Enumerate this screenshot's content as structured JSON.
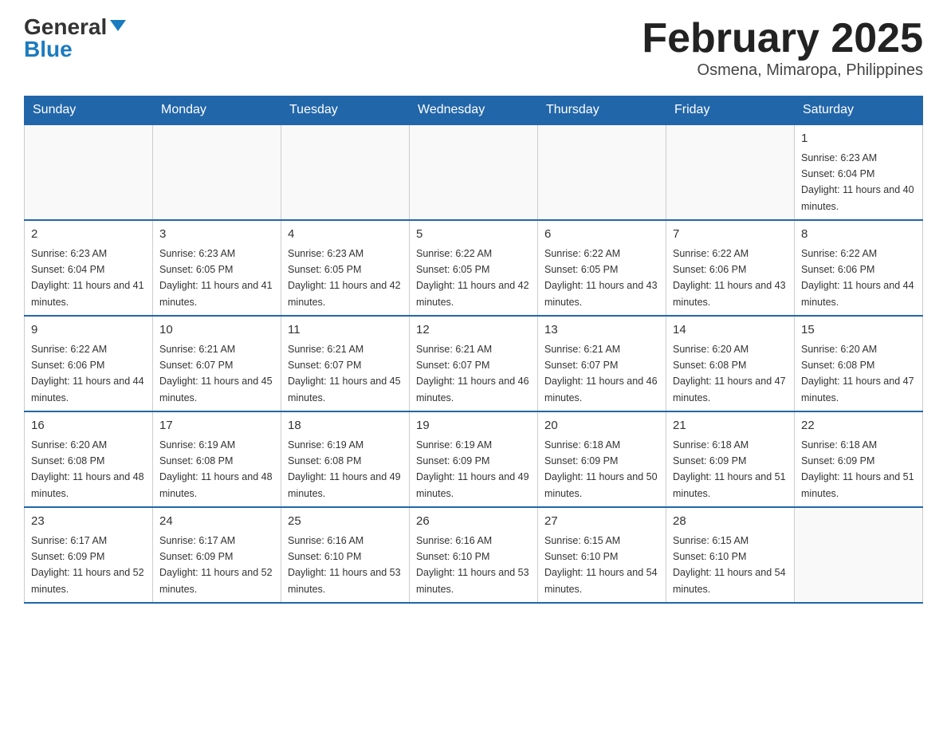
{
  "logo": {
    "general": "General",
    "blue": "Blue"
  },
  "title": "February 2025",
  "location": "Osmena, Mimaropa, Philippines",
  "days_of_week": [
    "Sunday",
    "Monday",
    "Tuesday",
    "Wednesday",
    "Thursday",
    "Friday",
    "Saturday"
  ],
  "weeks": [
    [
      {
        "day": "",
        "info": ""
      },
      {
        "day": "",
        "info": ""
      },
      {
        "day": "",
        "info": ""
      },
      {
        "day": "",
        "info": ""
      },
      {
        "day": "",
        "info": ""
      },
      {
        "day": "",
        "info": ""
      },
      {
        "day": "1",
        "info": "Sunrise: 6:23 AM\nSunset: 6:04 PM\nDaylight: 11 hours and 40 minutes."
      }
    ],
    [
      {
        "day": "2",
        "info": "Sunrise: 6:23 AM\nSunset: 6:04 PM\nDaylight: 11 hours and 41 minutes."
      },
      {
        "day": "3",
        "info": "Sunrise: 6:23 AM\nSunset: 6:05 PM\nDaylight: 11 hours and 41 minutes."
      },
      {
        "day": "4",
        "info": "Sunrise: 6:23 AM\nSunset: 6:05 PM\nDaylight: 11 hours and 42 minutes."
      },
      {
        "day": "5",
        "info": "Sunrise: 6:22 AM\nSunset: 6:05 PM\nDaylight: 11 hours and 42 minutes."
      },
      {
        "day": "6",
        "info": "Sunrise: 6:22 AM\nSunset: 6:05 PM\nDaylight: 11 hours and 43 minutes."
      },
      {
        "day": "7",
        "info": "Sunrise: 6:22 AM\nSunset: 6:06 PM\nDaylight: 11 hours and 43 minutes."
      },
      {
        "day": "8",
        "info": "Sunrise: 6:22 AM\nSunset: 6:06 PM\nDaylight: 11 hours and 44 minutes."
      }
    ],
    [
      {
        "day": "9",
        "info": "Sunrise: 6:22 AM\nSunset: 6:06 PM\nDaylight: 11 hours and 44 minutes."
      },
      {
        "day": "10",
        "info": "Sunrise: 6:21 AM\nSunset: 6:07 PM\nDaylight: 11 hours and 45 minutes."
      },
      {
        "day": "11",
        "info": "Sunrise: 6:21 AM\nSunset: 6:07 PM\nDaylight: 11 hours and 45 minutes."
      },
      {
        "day": "12",
        "info": "Sunrise: 6:21 AM\nSunset: 6:07 PM\nDaylight: 11 hours and 46 minutes."
      },
      {
        "day": "13",
        "info": "Sunrise: 6:21 AM\nSunset: 6:07 PM\nDaylight: 11 hours and 46 minutes."
      },
      {
        "day": "14",
        "info": "Sunrise: 6:20 AM\nSunset: 6:08 PM\nDaylight: 11 hours and 47 minutes."
      },
      {
        "day": "15",
        "info": "Sunrise: 6:20 AM\nSunset: 6:08 PM\nDaylight: 11 hours and 47 minutes."
      }
    ],
    [
      {
        "day": "16",
        "info": "Sunrise: 6:20 AM\nSunset: 6:08 PM\nDaylight: 11 hours and 48 minutes."
      },
      {
        "day": "17",
        "info": "Sunrise: 6:19 AM\nSunset: 6:08 PM\nDaylight: 11 hours and 48 minutes."
      },
      {
        "day": "18",
        "info": "Sunrise: 6:19 AM\nSunset: 6:08 PM\nDaylight: 11 hours and 49 minutes."
      },
      {
        "day": "19",
        "info": "Sunrise: 6:19 AM\nSunset: 6:09 PM\nDaylight: 11 hours and 49 minutes."
      },
      {
        "day": "20",
        "info": "Sunrise: 6:18 AM\nSunset: 6:09 PM\nDaylight: 11 hours and 50 minutes."
      },
      {
        "day": "21",
        "info": "Sunrise: 6:18 AM\nSunset: 6:09 PM\nDaylight: 11 hours and 51 minutes."
      },
      {
        "day": "22",
        "info": "Sunrise: 6:18 AM\nSunset: 6:09 PM\nDaylight: 11 hours and 51 minutes."
      }
    ],
    [
      {
        "day": "23",
        "info": "Sunrise: 6:17 AM\nSunset: 6:09 PM\nDaylight: 11 hours and 52 minutes."
      },
      {
        "day": "24",
        "info": "Sunrise: 6:17 AM\nSunset: 6:09 PM\nDaylight: 11 hours and 52 minutes."
      },
      {
        "day": "25",
        "info": "Sunrise: 6:16 AM\nSunset: 6:10 PM\nDaylight: 11 hours and 53 minutes."
      },
      {
        "day": "26",
        "info": "Sunrise: 6:16 AM\nSunset: 6:10 PM\nDaylight: 11 hours and 53 minutes."
      },
      {
        "day": "27",
        "info": "Sunrise: 6:15 AM\nSunset: 6:10 PM\nDaylight: 11 hours and 54 minutes."
      },
      {
        "day": "28",
        "info": "Sunrise: 6:15 AM\nSunset: 6:10 PM\nDaylight: 11 hours and 54 minutes."
      },
      {
        "day": "",
        "info": ""
      }
    ]
  ]
}
